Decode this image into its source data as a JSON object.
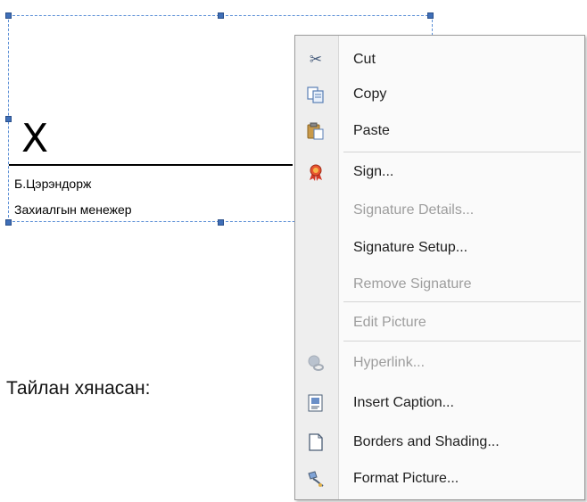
{
  "signature": {
    "mark": "X",
    "name": "Б.Цэрэндорж",
    "role": "Захиалгын менежер"
  },
  "document": {
    "report_label": "Тайлан хянасан:"
  },
  "context_menu": {
    "items": [
      {
        "label": "Cut",
        "icon": "scissors-icon",
        "enabled": true
      },
      {
        "label": "Copy",
        "icon": "copy-icon",
        "enabled": true
      },
      {
        "label": "Paste",
        "icon": "paste-icon",
        "enabled": true
      },
      {
        "label": "Sign...",
        "icon": "ribbon-icon",
        "enabled": true
      },
      {
        "label": "Signature Details...",
        "icon": "",
        "enabled": false
      },
      {
        "label": "Signature Setup...",
        "icon": "",
        "enabled": true
      },
      {
        "label": "Remove Signature",
        "icon": "",
        "enabled": false
      },
      {
        "label": "Edit Picture",
        "icon": "",
        "enabled": false
      },
      {
        "label": "Hyperlink...",
        "icon": "globe-link-icon",
        "enabled": false
      },
      {
        "label": "Insert Caption...",
        "icon": "caption-icon",
        "enabled": true
      },
      {
        "label": "Borders and Shading...",
        "icon": "page-border-icon",
        "enabled": true
      },
      {
        "label": "Format Picture...",
        "icon": "format-brush-icon",
        "enabled": true
      }
    ]
  },
  "colors": {
    "selection_border": "#5b8fd6",
    "menu_gutter": "#eeeeee",
    "disabled_text": "#9d9d9d"
  }
}
